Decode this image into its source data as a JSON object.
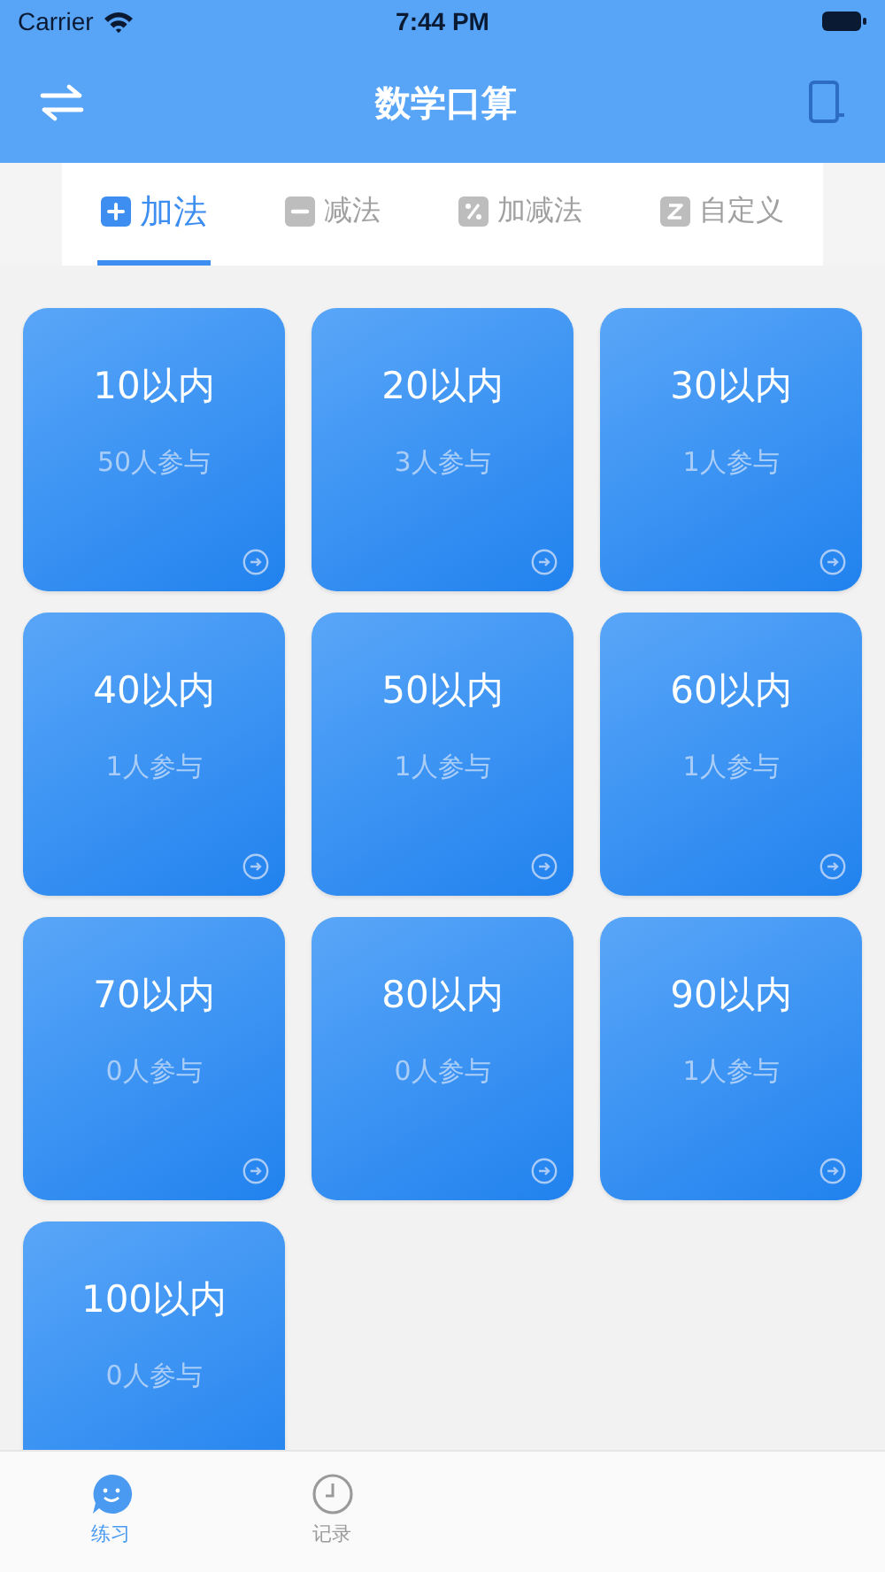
{
  "status_bar": {
    "carrier": "Carrier",
    "time": "7:44 PM"
  },
  "nav": {
    "title": "数学口算"
  },
  "tabs": [
    {
      "label": "加法",
      "kind": "plus",
      "selected": true
    },
    {
      "label": "减法",
      "kind": "minus",
      "selected": false
    },
    {
      "label": "加减法",
      "kind": "mixed",
      "selected": false
    },
    {
      "label": "自定义",
      "kind": "custom",
      "selected": false
    }
  ],
  "cards": [
    {
      "title": "10以内",
      "participants": "50人参与"
    },
    {
      "title": "20以内",
      "participants": "3人参与"
    },
    {
      "title": "30以内",
      "participants": "1人参与"
    },
    {
      "title": "40以内",
      "participants": "1人参与"
    },
    {
      "title": "50以内",
      "participants": "1人参与"
    },
    {
      "title": "60以内",
      "participants": "1人参与"
    },
    {
      "title": "70以内",
      "participants": "0人参与"
    },
    {
      "title": "80以内",
      "participants": "0人参与"
    },
    {
      "title": "90以内",
      "participants": "1人参与"
    },
    {
      "title": "100以内",
      "participants": "0人参与",
      "arrow": false
    }
  ],
  "bottom_tabs": [
    {
      "label": "练习",
      "kind": "practice",
      "selected": true
    },
    {
      "label": "记录",
      "kind": "record",
      "selected": false
    }
  ]
}
